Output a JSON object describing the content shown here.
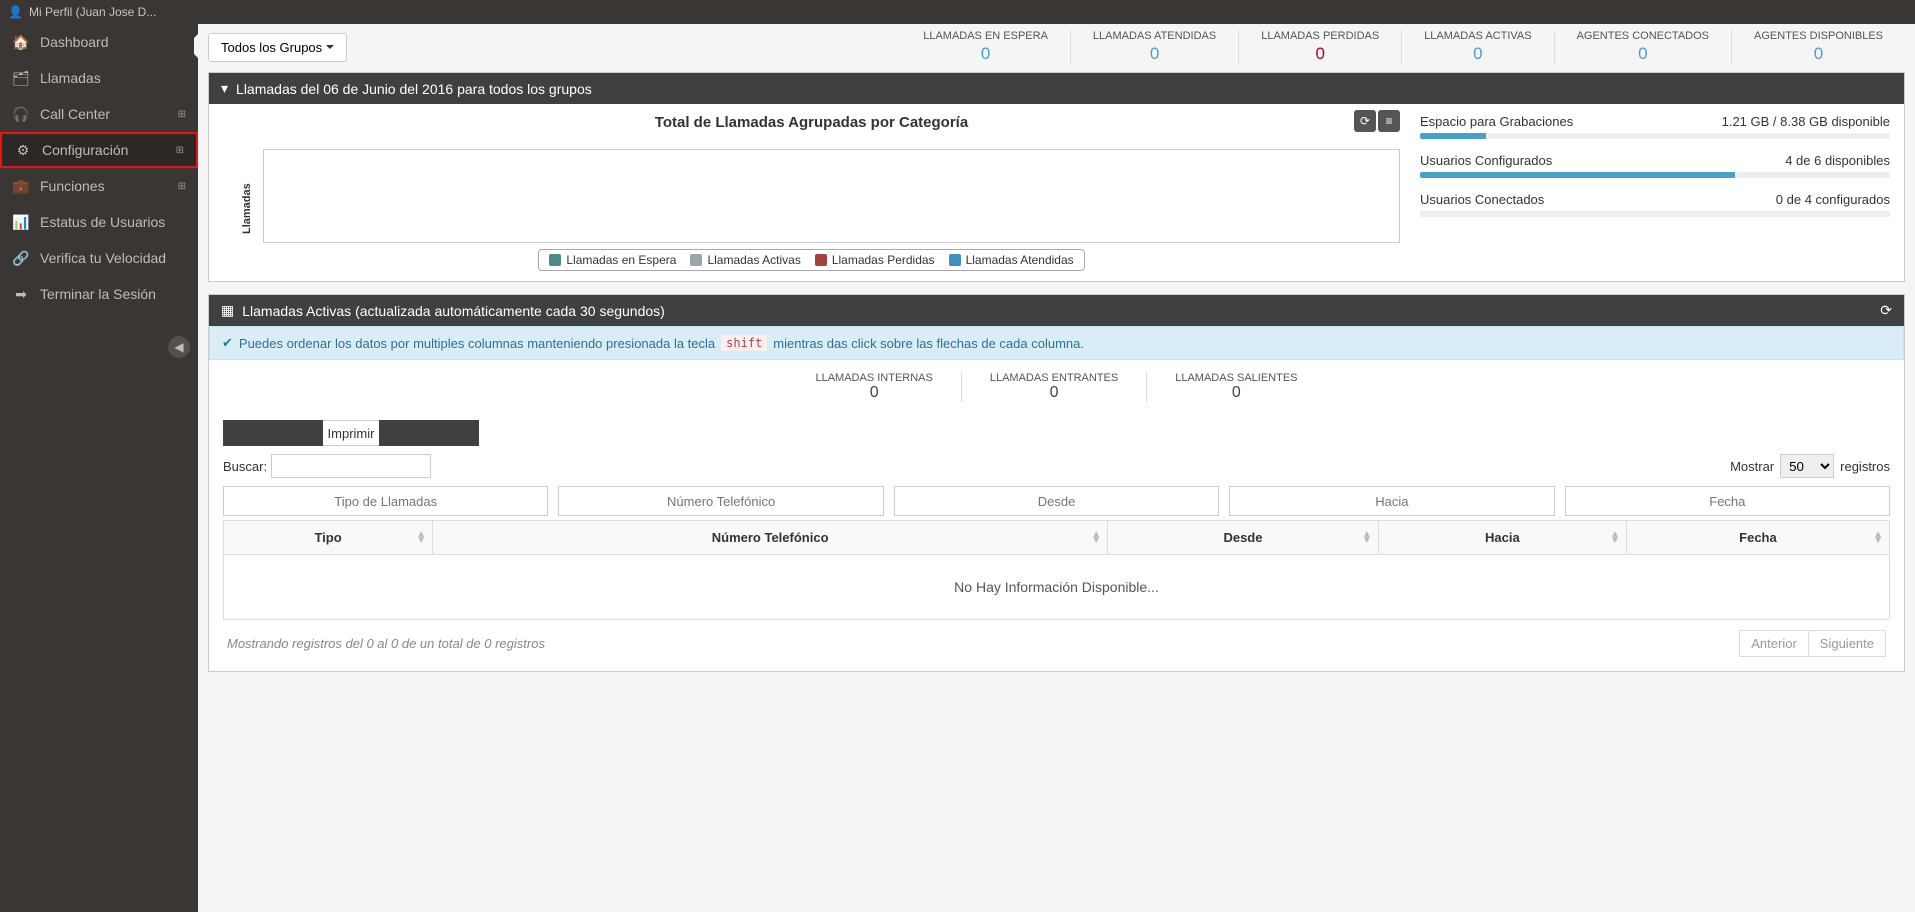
{
  "topbar": {
    "profile_label": "Mi Perfil (Juan Jose D..."
  },
  "sidebar": {
    "items": [
      {
        "label": "Dashboard",
        "icon": "🏠"
      },
      {
        "label": "Llamadas",
        "icon": "🗂"
      },
      {
        "label": "Call Center",
        "icon": "🎧",
        "expandable": true
      },
      {
        "label": "Configuración",
        "icon": "⚙",
        "expandable": true,
        "highlight": true
      },
      {
        "label": "Funciones",
        "icon": "💼",
        "expandable": true
      },
      {
        "label": "Estatus de Usuarios",
        "icon": "📊"
      },
      {
        "label": "Verifica tu Velocidad",
        "icon": "🔗"
      },
      {
        "label": "Terminar la Sesión",
        "icon": "➡"
      }
    ]
  },
  "groups_button": "Todos los Grupos",
  "top_stats": [
    {
      "label": "LLAMADAS EN ESPERA",
      "value": "0"
    },
    {
      "label": "LLAMADAS ATENDIDAS",
      "value": "0"
    },
    {
      "label": "LLAMADAS PERDIDAS",
      "value": "0",
      "red": true
    },
    {
      "label": "LLAMADAS ACTIVAS",
      "value": "0"
    },
    {
      "label": "AGENTES CONECTADOS",
      "value": "0"
    },
    {
      "label": "AGENTES DISPONIBLES",
      "value": "0"
    }
  ],
  "panel1": {
    "title": "Llamadas del 06 de Junio del 2016 para todos los grupos",
    "chart_title": "Total de Llamadas Agrupadas por Categoría",
    "y_label": "Llamadas",
    "legend": [
      {
        "label": "Llamadas en Espera",
        "color": "#4f8a8b"
      },
      {
        "label": "Llamadas Activas",
        "color": "#9aa3a7"
      },
      {
        "label": "Llamadas Perdidas",
        "color": "#a3403e"
      },
      {
        "label": "Llamadas Atendidas",
        "color": "#3f8fbf"
      }
    ],
    "info": [
      {
        "label": "Espacio para Grabaciones",
        "value": "1.21 GB / 8.38 GB disponible",
        "pct": 14
      },
      {
        "label": "Usuarios Configurados",
        "value": "4 de 6 disponibles",
        "pct": 67
      },
      {
        "label": "Usuarios Conectados",
        "value": "0 de 4 configurados",
        "pct": 0
      }
    ]
  },
  "panel2": {
    "title": "Llamadas Activas (actualizada automáticamente cada 30 segundos)",
    "tip_before": "Puedes ordenar los datos por multiples columnas manteniendo presionada la tecla",
    "tip_code": "shift",
    "tip_after": "mientras das click sobre las flechas de cada columna.",
    "mini_stats": [
      {
        "label": "LLAMADAS INTERNAS",
        "value": "0"
      },
      {
        "label": "LLAMADAS ENTRANTES",
        "value": "0"
      },
      {
        "label": "LLAMADAS SALIENTES",
        "value": "0"
      }
    ],
    "print_label": "Imprimir",
    "search_label": "Buscar:",
    "show_label": "Mostrar",
    "show_value": "50",
    "records_label": "registros",
    "filters": [
      "Tipo de Llamadas",
      "Número Telefónico",
      "Desde",
      "Hacia",
      "Fecha"
    ],
    "columns": [
      "Tipo",
      "Número Telefónico",
      "Desde",
      "Hacia",
      "Fecha"
    ],
    "empty": "No Hay Información Disponible...",
    "footer": "Mostrando registros del 0 al 0 de un total de 0 registros",
    "prev": "Anterior",
    "next": "Siguiente"
  },
  "chart_data": {
    "type": "bar",
    "title": "Total de Llamadas Agrupadas por Categoría",
    "ylabel": "Llamadas",
    "categories": [],
    "series": [
      {
        "name": "Llamadas en Espera",
        "values": []
      },
      {
        "name": "Llamadas Activas",
        "values": []
      },
      {
        "name": "Llamadas Perdidas",
        "values": []
      },
      {
        "name": "Llamadas Atendidas",
        "values": []
      }
    ]
  }
}
